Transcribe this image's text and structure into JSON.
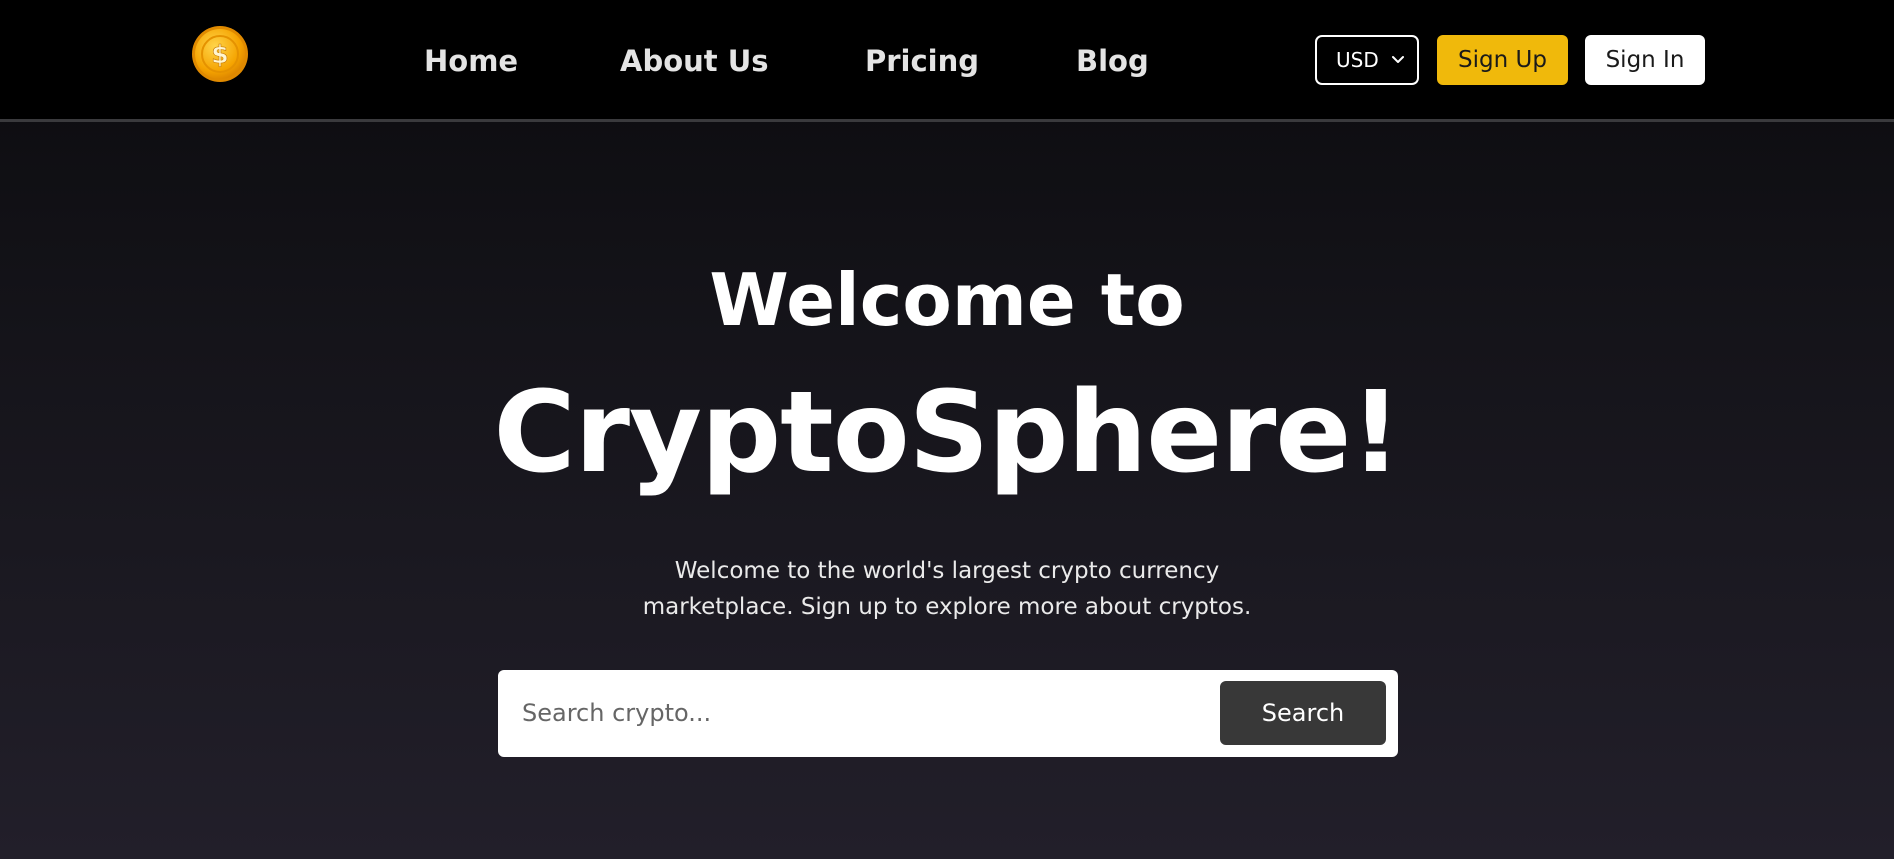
{
  "header": {
    "logo_icon": "dollar-coin-icon",
    "nav": [
      {
        "label": "Home"
      },
      {
        "label": "About Us"
      },
      {
        "label": "Pricing"
      },
      {
        "label": "Blog"
      }
    ],
    "currency": {
      "selected": "USD",
      "icon": "chevron-down-icon"
    },
    "signup_label": "Sign Up",
    "signin_label": "Sign In"
  },
  "hero": {
    "title_line1": "Welcome to",
    "title_line2": "CryptoSphere!",
    "subtitle": "Welcome to the world's largest crypto currency marketplace. Sign up to explore more about cryptos."
  },
  "search": {
    "placeholder": "Search crypto...",
    "button_label": "Search"
  },
  "colors": {
    "accent": "#f0b90b",
    "nav_background": "#000000",
    "page_gradient_top": "#0b0b0e",
    "page_gradient_bottom": "#221f2a",
    "search_button": "#383838"
  }
}
